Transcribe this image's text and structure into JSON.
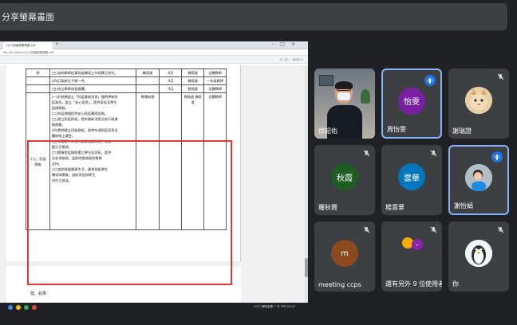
{
  "banner": {
    "title": "分享螢幕畫面"
  },
  "browser": {
    "tab_title": "11(1)班級經營規劃.pdf",
    "url": "file:///C:/Users/11(1)班級經營規劃.pdf",
    "tools": "1 / 12   −  100%  +"
  },
  "doc": {
    "rows_top": [
      {
        "cat": "感",
        "text": [
          "(三)協助教師從事班級輔導工作相關之研究。"
        ],
        "unit": "輔導處",
        "freq": "8月",
        "host": "輔導處",
        "att": "全體教師"
      },
      {
        "cat": "",
        "text": [
          "(四)訂製新生手冊一件。"
        ],
        "unit": "",
        "freq": "9月",
        "host": "輔導處",
        "att": "一年級教師"
      },
      {
        "cat": "",
        "text": [
          "(五)成立教師成長團體。"
        ],
        "unit": "",
        "freq": "9月",
        "host": "教務處",
        "att": "全體教師"
      }
    ],
    "section": {
      "cat": "十九、防疫 策略",
      "unit": "專責辦理",
      "host": "教務處 輔導處",
      "att": "全體教師",
      "lines": [
        "(一)於校網設立「防疫最新消息」隨時更新防",
        "疫資訊，設立「安心宿舍」，提供家長及學生",
        "諮詢服務。",
        "(二)防疫期間提供安心防疫輔導諮詢。",
        "(三)建立防疫群組，提供最新消息及各行政業",
        "務連繫。",
        "(四)教師建立班級群組，即時布達防疫訊息及",
        "觸碰線上課堂。",
        "(五)與健康中心保持聯繫追蹤狀況，以掌",
        "握生活情境。",
        "(六)關懷受疫情影響之學生與家長，提供",
        "及各項協助，並即時處理個別情緒",
        "支持。",
        "(七)協助發展健康生活，重視班級學生",
        "輔導與關懷，協助家長與學生",
        "合作之效益。"
      ]
    },
    "page2_text": "陸、結果："
  },
  "taskbar": {
    "status": "25°C 晴時多雲  ^  中  下午 04:27"
  },
  "participants": [
    {
      "name": "徐韶佑",
      "type": "video"
    },
    {
      "name": "周怡雯",
      "avatar_text": "怡雯",
      "avatar_color": "#7b1fa2",
      "speaking": true
    },
    {
      "name": "謝瑞證",
      "type": "cat"
    },
    {
      "name": "羅秋霞",
      "avatar_text": "秋霞",
      "avatar_color": "#1b5e20"
    },
    {
      "name": "楊雲華",
      "avatar_text": "雲華",
      "avatar_color": "#0277bd"
    },
    {
      "name": "謝怡娟",
      "type": "photo",
      "speaking": true
    },
    {
      "name": "meeting ccps",
      "avatar_text": "m",
      "avatar_color": "#8d4a1f"
    },
    {
      "name": "還有另外 9 位使用者",
      "type": "more"
    },
    {
      "name": "你",
      "type": "penguin"
    }
  ]
}
